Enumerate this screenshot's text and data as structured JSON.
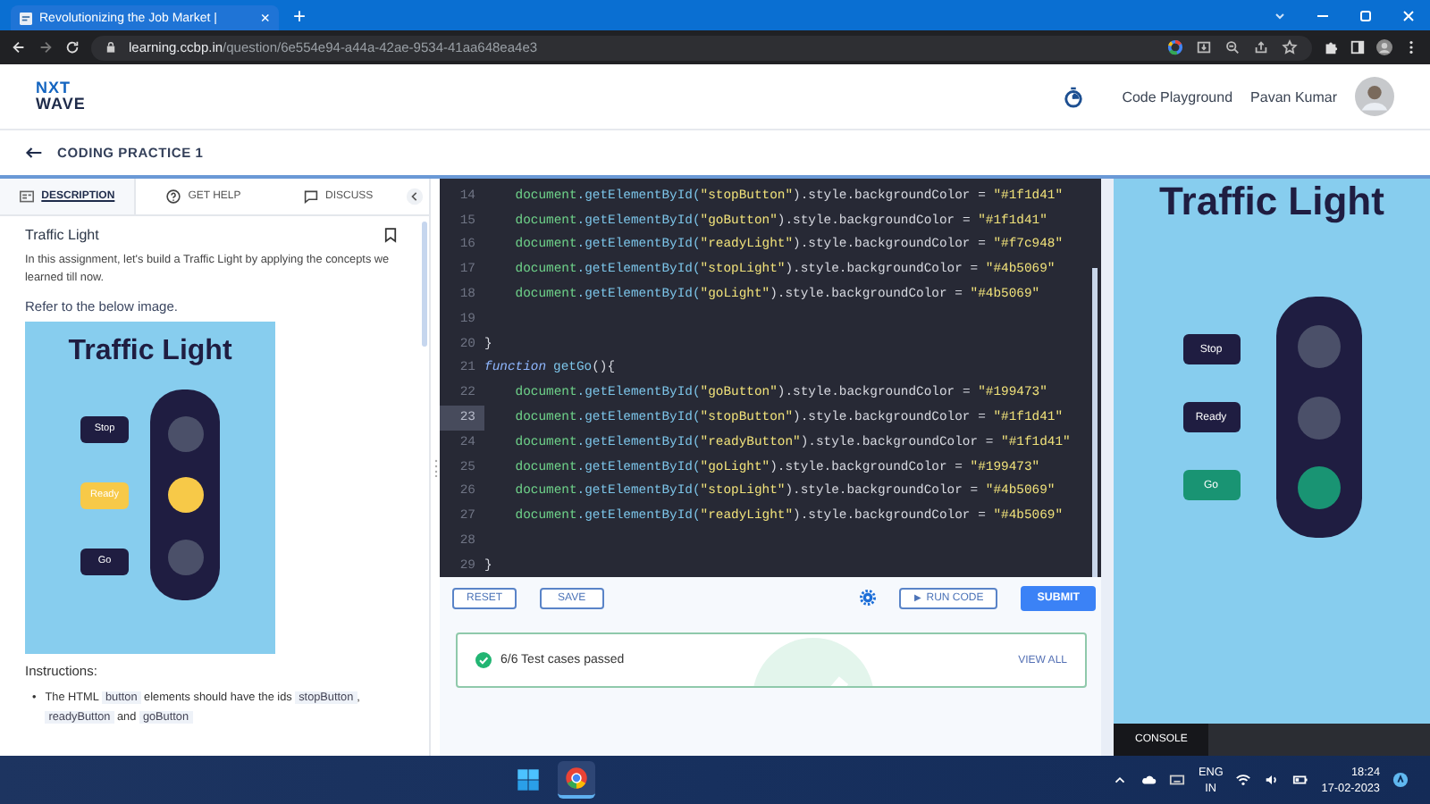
{
  "browser": {
    "tab_title": "Revolutionizing the Job Market |",
    "tab_close": "×",
    "new_tab": "+",
    "url_host": "learning.ccbp.in",
    "url_path": "/question/6e554e94-a44a-42ae-9534-41aa648ea4e3"
  },
  "header": {
    "logo_top": "NXT",
    "logo_bottom": "WAVE",
    "link": "Code Playground",
    "user": "Pavan Kumar"
  },
  "subheader": {
    "title": "CODING PRACTICE 1"
  },
  "left_tabs": [
    {
      "label": "DESCRIPTION",
      "kind": "doc",
      "selected": true
    },
    {
      "label": "GET HELP",
      "kind": "help",
      "selected": false
    },
    {
      "label": "DISCUSS",
      "kind": "chat",
      "selected": false
    }
  ],
  "description": {
    "title": "Traffic Light",
    "intro": "In this assignment, let's build a Traffic Light by applying the concepts we learned till now.",
    "refer": "Refer to the below image.",
    "instructions": "Instructions:",
    "marker": "•",
    "bullet": [
      "The HTML ",
      "button",
      " elements should have the ids ",
      "stopButton",
      ", ",
      "readyButton",
      " and ",
      "goButton"
    ]
  },
  "sample": {
    "title": "Traffic Light",
    "buttons": [
      {
        "label": "Stop",
        "color": "#1f1d41"
      },
      {
        "label": "Ready",
        "color": "#f7c948"
      },
      {
        "label": "Go",
        "color": "#1f1d41"
      }
    ],
    "lights": [
      {
        "color": "#4b5069"
      },
      {
        "color": "#f7c948"
      },
      {
        "color": "#4b5069"
      }
    ]
  },
  "code_lines": [
    {
      "number": "14",
      "selected": false,
      "segments": [
        {
          "kind": "obj",
          "text": "    document"
        },
        {
          "kind": "fn",
          "text": ".getElementById("
        },
        {
          "kind": "str",
          "text": "\"stopButton\""
        },
        {
          "kind": "plain",
          "text": ").style.backgroundColor = "
        },
        {
          "kind": "str",
          "text": "\"#1f1d41\""
        }
      ]
    },
    {
      "number": "15",
      "selected": false,
      "segments": [
        {
          "kind": "obj",
          "text": "    document"
        },
        {
          "kind": "fn",
          "text": ".getElementById("
        },
        {
          "kind": "str",
          "text": "\"goButton\""
        },
        {
          "kind": "plain",
          "text": ").style.backgroundColor = "
        },
        {
          "kind": "str",
          "text": "\"#1f1d41\""
        }
      ]
    },
    {
      "number": "16",
      "selected": false,
      "segments": [
        {
          "kind": "obj",
          "text": "    document"
        },
        {
          "kind": "fn",
          "text": ".getElementById("
        },
        {
          "kind": "str",
          "text": "\"readyLight\""
        },
        {
          "kind": "plain",
          "text": ").style.backgroundColor = "
        },
        {
          "kind": "str",
          "text": "\"#f7c948\""
        }
      ]
    },
    {
      "number": "17",
      "selected": false,
      "segments": [
        {
          "kind": "obj",
          "text": "    document"
        },
        {
          "kind": "fn",
          "text": ".getElementById("
        },
        {
          "kind": "str",
          "text": "\"stopLight\""
        },
        {
          "kind": "plain",
          "text": ").style.backgroundColor = "
        },
        {
          "kind": "str",
          "text": "\"#4b5069\""
        }
      ]
    },
    {
      "number": "18",
      "selected": false,
      "segments": [
        {
          "kind": "obj",
          "text": "    document"
        },
        {
          "kind": "fn",
          "text": ".getElementById("
        },
        {
          "kind": "str",
          "text": "\"goLight\""
        },
        {
          "kind": "plain",
          "text": ").style.backgroundColor = "
        },
        {
          "kind": "str",
          "text": "\"#4b5069\""
        }
      ]
    },
    {
      "number": "19",
      "selected": false
    },
    {
      "number": "20",
      "selected": false,
      "segments": [
        {
          "kind": "plain",
          "text": "}"
        }
      ]
    },
    {
      "number": "21",
      "selected": false,
      "segments": [
        {
          "kind": "kw",
          "text": "function"
        },
        {
          "kind": "fn",
          "text": "getGo"
        },
        {
          "kind": "plain",
          "text": "(){"
        }
      ]
    },
    {
      "number": "22",
      "selected": false,
      "segments": [
        {
          "kind": "obj",
          "text": "    document"
        },
        {
          "kind": "fn",
          "text": ".getElementById("
        },
        {
          "kind": "str",
          "text": "\"goButton\""
        },
        {
          "kind": "plain",
          "text": ").style.backgroundColor = "
        },
        {
          "kind": "str",
          "text": "\"#199473\""
        }
      ]
    },
    {
      "number": "23",
      "selected": true,
      "segments": [
        {
          "kind": "obj",
          "text": "    document"
        },
        {
          "kind": "fn",
          "text": ".getElementById("
        },
        {
          "kind": "str",
          "text": "\"stopButton\""
        },
        {
          "kind": "plain",
          "text": ").style.backgroundColor = "
        },
        {
          "kind": "str",
          "text": "\"#1f1d41\""
        }
      ]
    },
    {
      "number": "24",
      "selected": false,
      "segments": [
        {
          "kind": "obj",
          "text": "    document"
        },
        {
          "kind": "fn",
          "text": ".getElementById("
        },
        {
          "kind": "str",
          "text": "\"readyButton\""
        },
        {
          "kind": "plain",
          "text": ").style.backgroundColor = "
        },
        {
          "kind": "str",
          "text": "\"#1f1d41\""
        }
      ]
    },
    {
      "number": "25",
      "selected": false,
      "segments": [
        {
          "kind": "obj",
          "text": "    document"
        },
        {
          "kind": "fn",
          "text": ".getElementById("
        },
        {
          "kind": "str",
          "text": "\"goLight\""
        },
        {
          "kind": "plain",
          "text": ").style.backgroundColor = "
        },
        {
          "kind": "str",
          "text": "\"#199473\""
        }
      ]
    },
    {
      "number": "26",
      "selected": false,
      "segments": [
        {
          "kind": "obj",
          "text": "    document"
        },
        {
          "kind": "fn",
          "text": ".getElementById("
        },
        {
          "kind": "str",
          "text": "\"stopLight\""
        },
        {
          "kind": "plain",
          "text": ").style.backgroundColor = "
        },
        {
          "kind": "str",
          "text": "\"#4b5069\""
        }
      ]
    },
    {
      "number": "27",
      "selected": false,
      "segments": [
        {
          "kind": "obj",
          "text": "    document"
        },
        {
          "kind": "fn",
          "text": ".getElementById("
        },
        {
          "kind": "str",
          "text": "\"readyLight\""
        },
        {
          "kind": "plain",
          "text": ").style.backgroundColor = "
        },
        {
          "kind": "str",
          "text": "\"#4b5069\""
        }
      ]
    },
    {
      "number": "28",
      "selected": false
    },
    {
      "number": "29",
      "selected": false,
      "segments": [
        {
          "kind": "plain",
          "text": "}"
        }
      ]
    }
  ],
  "toolbar": {
    "reset": "RESET",
    "save": "SAVE",
    "run_icon": "▶",
    "run": "RUN CODE",
    "submit": "SUBMIT"
  },
  "result": {
    "text": "6/6 Test cases passed",
    "link": "VIEW ALL"
  },
  "preview": {
    "title": "Traffic Light",
    "buttons": [
      {
        "label": "Stop",
        "color": "#1f1d41"
      },
      {
        "label": "Ready",
        "color": "#1f1d41"
      },
      {
        "label": "Go",
        "color": "#199473"
      }
    ],
    "lights": [
      {
        "color": "#4b5069"
      },
      {
        "color": "#4b5069"
      },
      {
        "color": "#199473"
      }
    ],
    "console": "CONSOLE"
  },
  "taskbar": {
    "lang_top": "ENG",
    "lang_bottom": "IN",
    "time": "18:24",
    "date": "17-02-2023"
  }
}
